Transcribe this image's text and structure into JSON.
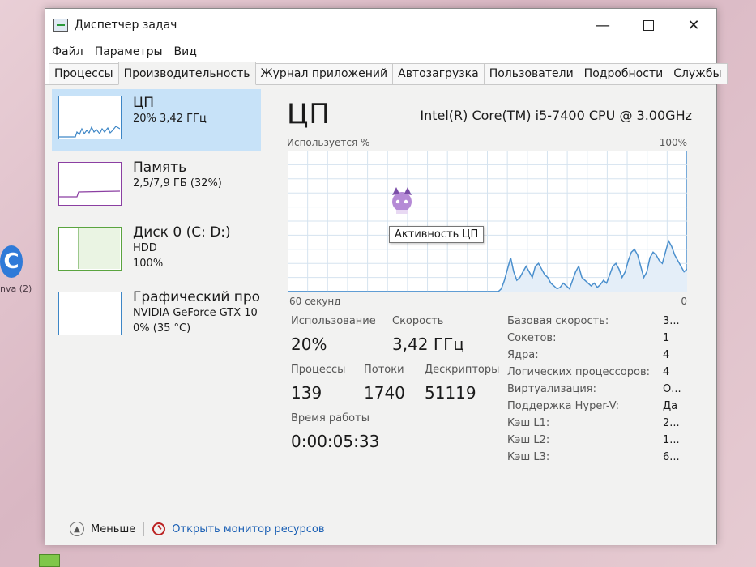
{
  "window": {
    "title": "Диспетчер задач",
    "controls": {
      "minimize": "—",
      "close": "✕"
    }
  },
  "menu": [
    "Файл",
    "Параметры",
    "Вид"
  ],
  "tabs": [
    {
      "label": "Процессы"
    },
    {
      "label": "Производительность",
      "active": true
    },
    {
      "label": "Журнал приложений"
    },
    {
      "label": "Автозагрузка"
    },
    {
      "label": "Пользователи"
    },
    {
      "label": "Подробности"
    },
    {
      "label": "Службы"
    }
  ],
  "sidebar": {
    "items": [
      {
        "title": "ЦП",
        "line1": "20% 3,42 ГГц",
        "line2": "",
        "selected": true
      },
      {
        "title": "Память",
        "line1": "2,5/7,9 ГБ (32%)",
        "line2": ""
      },
      {
        "title": "Диск 0 (C: D:)",
        "line1": "HDD",
        "line2": "100%"
      },
      {
        "title": "Графический про",
        "line1": "NVIDIA GeForce GTX 10",
        "line2": "0% (35 °C)"
      }
    ]
  },
  "cpu": {
    "heading": "ЦП",
    "model": "Intel(R) Core(TM) i5-7400 CPU @ 3.00GHz",
    "graph_label": "Используется %",
    "graph_max": "100%",
    "graph_time": "60 секунд",
    "graph_min": "0",
    "tooltip": "Активность ЦП",
    "stats": {
      "usage_label": "Использование",
      "usage_value": "20%",
      "speed_label": "Скорость",
      "speed_value": "3,42 ГГц",
      "processes_label": "Процессы",
      "processes_value": "139",
      "threads_label": "Потоки",
      "threads_value": "1740",
      "handles_label": "Дескрипторы",
      "handles_value": "51119",
      "uptime_label": "Время работы",
      "uptime_value": "0:00:05:33"
    },
    "properties": [
      {
        "key": "Базовая скорость:",
        "value": "3..."
      },
      {
        "key": "Сокетов:",
        "value": "1"
      },
      {
        "key": "Ядра:",
        "value": "4"
      },
      {
        "key": "Логических процессоров:",
        "value": "4"
      },
      {
        "key": "Виртуализация:",
        "value": "О..."
      },
      {
        "key": "Поддержка Hyper-V:",
        "value": "Да"
      },
      {
        "key": "Кэш L1:",
        "value": "2..."
      },
      {
        "key": "Кэш L2:",
        "value": "1..."
      },
      {
        "key": "Кэш L3:",
        "value": "6..."
      }
    ],
    "history": [
      0,
      0,
      0,
      0,
      0,
      0,
      0,
      0,
      0,
      0,
      0,
      0,
      0,
      0,
      0,
      0,
      0,
      0,
      0,
      0,
      0,
      0,
      0,
      0,
      0,
      0,
      0,
      0,
      0,
      0,
      0,
      0,
      0,
      0,
      0,
      0,
      0,
      0,
      0,
      0,
      0,
      0,
      0,
      0,
      0,
      0,
      0,
      0,
      0,
      0,
      0,
      0,
      0,
      0,
      0,
      0,
      0,
      0,
      0,
      0,
      0,
      0,
      0,
      0,
      0,
      0,
      0,
      0,
      0,
      2,
      8,
      16,
      24,
      14,
      8,
      10,
      14,
      18,
      14,
      10,
      18,
      20,
      16,
      12,
      10,
      6,
      4,
      2,
      3,
      6,
      4,
      2,
      8,
      14,
      18,
      10,
      8,
      6,
      4,
      6,
      3,
      5,
      8,
      6,
      12,
      18,
      20,
      16,
      10,
      14,
      22,
      28,
      30,
      26,
      18,
      10,
      14,
      24,
      28,
      26,
      22,
      20,
      28,
      36,
      32,
      26,
      22,
      18,
      14,
      16
    ]
  },
  "footer": {
    "less_label": "Меньше",
    "monitor_label": "Открыть монитор ресурсов"
  },
  "desktop": {
    "icon_label": "nva (2)"
  },
  "colors": {
    "cpu_line": "#4a8fcd",
    "cpu_fill": "#e4eef8",
    "grid": "#d5e3ef",
    "memory": "#8b3fa2",
    "disk": "#5aa43f"
  }
}
